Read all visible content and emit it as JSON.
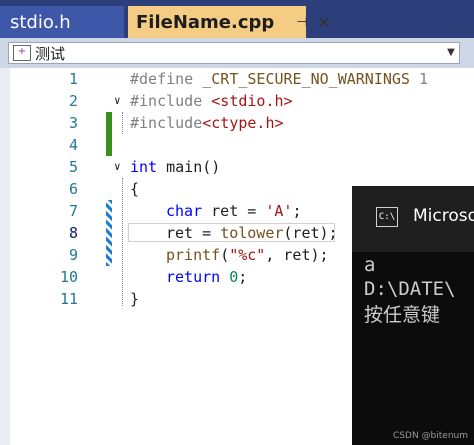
{
  "tabs": [
    {
      "label": "stdio.h",
      "active": false
    },
    {
      "label": "FileName.cpp",
      "active": true,
      "pin_glyph": "⊣",
      "close_glyph": "✕"
    }
  ],
  "scope": {
    "label": "测试",
    "dropdown_glyph": "▼",
    "icon_glyph": "+"
  },
  "editor": {
    "lines": [
      {
        "n": "1"
      },
      {
        "n": "2"
      },
      {
        "n": "3"
      },
      {
        "n": "4"
      },
      {
        "n": "5"
      },
      {
        "n": "6"
      },
      {
        "n": "7"
      },
      {
        "n": "8"
      },
      {
        "n": "9"
      },
      {
        "n": "10"
      },
      {
        "n": "11"
      }
    ],
    "current_line": "8",
    "code": {
      "l1_define": "#define",
      "l1_macro": " _CRT_SECURE_NO_WARNINGS",
      "l1_num": " 1",
      "l2_inc": "#include",
      "l2_hdr": " <stdio.h>",
      "l3_inc": "#include",
      "l3_hdr": "<ctype.h>",
      "l5_kw": "int",
      "l5_rest": " main()",
      "l6": "{",
      "l7_kw": "char",
      "l7_mid": " ret = ",
      "l7_str": "'A'",
      "l7_end": ";",
      "l8_a": "ret = ",
      "l8_fn": "tolower",
      "l8_b": "(ret);",
      "l9_fn": "printf",
      "l9_a": "(",
      "l9_str": "\"%c\"",
      "l9_b": ", ret);",
      "l10_kw": "return",
      "l10_num": " 0",
      "l10_end": ";",
      "l11": "}"
    },
    "fold_glyph": "∨"
  },
  "console": {
    "icon_text": "C:\\",
    "title": "Microso",
    "lines": [
      "a",
      "D:\\DATE\\",
      "按任意键"
    ]
  },
  "watermark": "CSDN @bitenum"
}
